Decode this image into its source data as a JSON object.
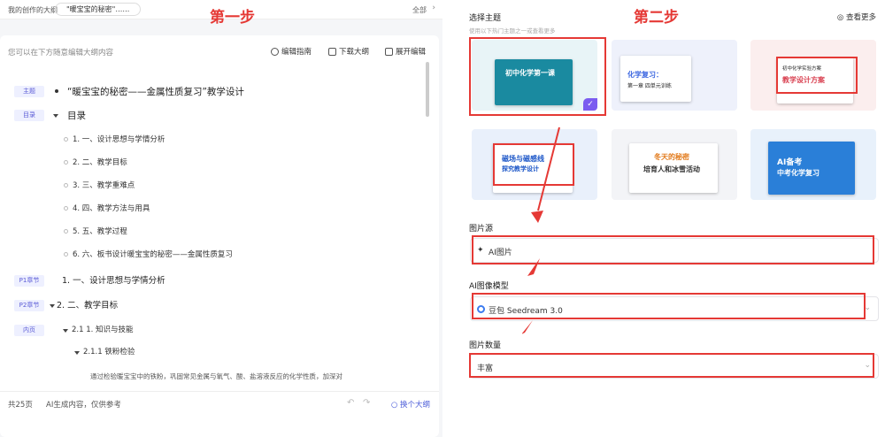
{
  "left": {
    "topbar": {
      "crumb": "我的创作的大纲",
      "pill": "\"暖宝宝的秘密\"……",
      "all": "全部"
    },
    "step_label": "第一步",
    "hint": "您可以在下方随意编辑大纲内容",
    "tools": {
      "guide": "编辑指南",
      "download": "下载大纲",
      "expand": "展开编辑"
    },
    "tags": {
      "topic": "主题",
      "toc": "目录",
      "p1": "P1章节",
      "p2": "P2章节",
      "content": "内页"
    },
    "outline": {
      "topic": "“暖宝宝的秘密——金属性质复习”教学设计",
      "toc": "目录",
      "toc_items": [
        "1.  一、设计思想与学情分析",
        "2.  二、教学目标",
        "3.  三、教学重难点",
        "4.  四、教学方法与用具",
        "5.  五、教学过程",
        "6.  六、板书设计暖宝宝的秘密——金属性质复习"
      ],
      "p1": "1.  一、设计思想与学情分析",
      "p2": "2.  二、教学目标",
      "sub1": "2.1   1. 知识与技能",
      "sub2": "2.1.1   铁粉检验",
      "para": "通过检验暖宝宝中的铁粉，巩固常见金属与氧气、酸、盐溶液反应的化学性质，加深对"
    },
    "footer": {
      "pages": "共25页",
      "note": "AI生成内容，仅供参考",
      "switch": "换个大纲"
    }
  },
  "right": {
    "step_label": "第二步",
    "theme_title": "选择主题",
    "theme_sub": "使用以下热门主题之一或查看更多",
    "more": "查看更多",
    "thumbs": [
      {
        "title": "初中化学第一课",
        "color": "#1a8aa0",
        "bg": "#e8f4f7"
      },
      {
        "title": "化学复习：",
        "subtitle": "第一章 四单元训练",
        "color": "#3b66e0",
        "bg": "#eef1fb"
      },
      {
        "title": "教学设计方案",
        "subtitle": "初中化学实验方案",
        "color": "#d94050",
        "bg": "#fbeeee"
      },
      {
        "title": "磁场与磁感线",
        "subtitle": "探究教学设计",
        "color": "#1d57c8",
        "bg": "#e9f0fb"
      },
      {
        "title": "冬天的秘密",
        "subtitle": "培育人和冰雪活动",
        "color": "#e27a1b",
        "bg": "#f3f4f7"
      },
      {
        "title": "AI备考",
        "subtitle": "中考化学复习",
        "color": "#2a7fd8",
        "bg": "#e8f1fb"
      }
    ],
    "img_source_title": "图片源",
    "img_source_value": "AI图片",
    "model_title": "AI图像模型",
    "model_value": "豆包 Seedream 3.0",
    "count_title": "图片数量",
    "count_value": "丰富"
  },
  "colors": {
    "accent": "#e53935",
    "brand": "#4a5bd8",
    "tag_bg": "#eef0ff"
  }
}
